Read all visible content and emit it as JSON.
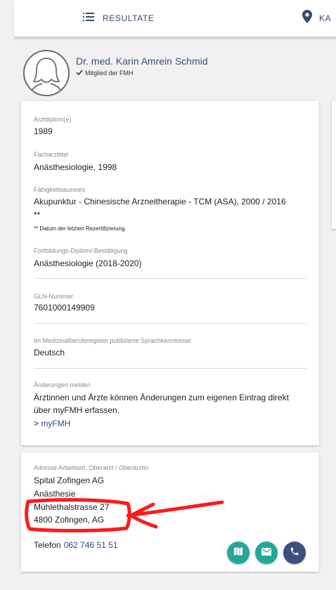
{
  "topbar": {
    "results_label": "RESULTATE",
    "map_label": "KA"
  },
  "profile": {
    "name": "Dr. med. Karin Amrein Schmid",
    "membership": "Mitglied der FMH"
  },
  "details": {
    "diploma": {
      "label": "Arztdiplom(e)",
      "value": "1989"
    },
    "specialist": {
      "label": "Facharzttitel",
      "value": "Anästhesiologie, 1998"
    },
    "capability": {
      "label": "Fähigkeitsausweis",
      "value": "Akupunktur - Chinesische Arzneitherapie - TCM (ASA), 2000 / 2016",
      "marker": "**",
      "note": "** Datum der letzten Rezertifizierung."
    },
    "training": {
      "label": "Fortbildungs-Diplom/-Bestätigung",
      "value": "Anästhesiologie (2018-2020)"
    },
    "gln": {
      "label": "GLN-Nummer",
      "value": "7601000149909"
    },
    "languages": {
      "label": "Im Medizinalberuferegister publizierte Sprachkenntnisse",
      "value": "Deutsch"
    },
    "changes": {
      "label": "Änderungen melden",
      "text_line1": "Ärztinnen und Ärzte können Änderungen zum eigenen Eintrag direkt",
      "text_line2": "über myFMH erfassen.",
      "link_prefix": "> ",
      "link_text": "myFMH"
    }
  },
  "address": {
    "label": "Adresse Arbeitsort, Oberarzt / Oberärztin",
    "line1": "Spital Zofingen AG",
    "line2": "Anästhesie",
    "line3": "Mühlethalstrasse 27",
    "line4": "4800 Zofingen, AG",
    "phone_label": "Telefon",
    "phone_number": "062 746 51 51"
  },
  "colors": {
    "accent_navy": "#2e4a7e",
    "fab_teal": "#26a69a",
    "fab_navy": "#3d4e82",
    "annotation_red": "#ff1a1a"
  },
  "icons": {
    "results": "list-icon",
    "map_tab": "location-pin-icon",
    "member": "checkmark-icon",
    "map_button": "map-icon",
    "mail_button": "mail-icon",
    "phone_button": "phone-icon"
  }
}
